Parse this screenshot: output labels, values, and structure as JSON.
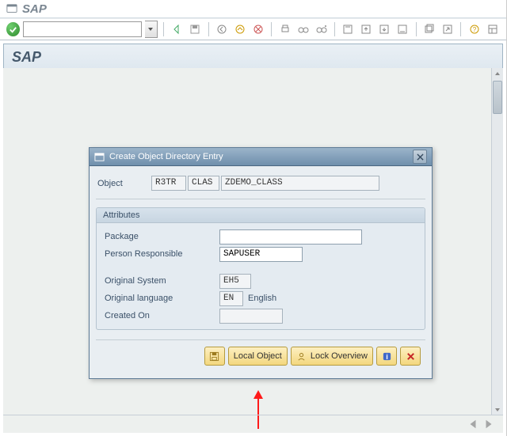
{
  "menubar": {
    "title": "SAP"
  },
  "toolbar": {
    "command_value": ""
  },
  "app": {
    "title": "SAP"
  },
  "dialog": {
    "title": "Create Object Directory Entry",
    "object_label": "Object",
    "object": {
      "pgmid": "R3TR",
      "objtype": "CLAS",
      "objname": "ZDEMO_CLASS"
    },
    "attributes_title": "Attributes",
    "fields": {
      "package_label": "Package",
      "package_value": "",
      "person_label": "Person Responsible",
      "person_value": "SAPUSER",
      "origsys_label": "Original System",
      "origsys_value": "EH5",
      "origlang_label": "Original language",
      "origlang_code": "EN",
      "origlang_text": "English",
      "created_label": "Created On",
      "created_value": ""
    },
    "buttons": {
      "save": "",
      "local_object": "Local Object",
      "lock_overview": "Lock Overview"
    }
  }
}
